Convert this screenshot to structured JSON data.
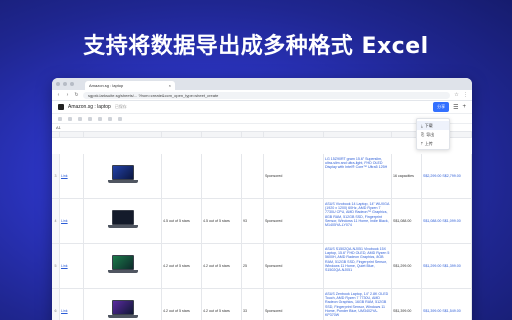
{
  "hero": {
    "title": "支持将数据导出成多种格式 Excel"
  },
  "browser": {
    "tab_title": "Amazon.sg : laptop",
    "url": "sgpxk.larksuite.sg/sheets/... ?from=create&ccm_open_type=sheet_create"
  },
  "app": {
    "doc_title": "Amazon.sg : laptop",
    "badge": "已保存",
    "share_label": "分享"
  },
  "dropdown": {
    "items": [
      {
        "label": "下载",
        "icon": "download-icon"
      },
      {
        "label": "导出",
        "icon": "export-icon"
      },
      {
        "label": "上传",
        "icon": "upload-icon"
      }
    ]
  },
  "formula": {
    "cell_ref": "A1"
  },
  "rows": [
    {
      "num": "3",
      "link": "Link",
      "rating": "",
      "rating2": "",
      "count": "",
      "sponsored": "Sponsored",
      "title": "LG 15Z90RT gram 15.6\" Superslim, ultra-slim and ultra-light, FHD OLED Display with Intel® Core™ Ultra5 125H",
      "price": "16 capacities",
      "prices": "S$2,299.00 S$2,799.00",
      "screen": "blue"
    },
    {
      "num": "4",
      "link": "Link",
      "rating": "4.5 out of 5 stars",
      "rating2": "4.5 out of 5 stars",
      "count": "93",
      "sponsored": "Sponsored",
      "title": "ASUS Vivobook 14 Laptop, 14\" WUXGA (1920 x 1200) 60Hz, AMD Ryzen 7 7730U CPU, AMD Radeon™ Graphics, 8GB RAM, 512GB SSD, Fingerprint Sensor, Windows 11 Home, Indie Black, M1405YA-LY074",
      "price": "S$1,088.00",
      "prices": "S$1,088.00 S$1,099.00",
      "screen": "dark"
    },
    {
      "num": "5",
      "link": "Link",
      "rating": "4.2 out of 5 stars",
      "rating2": "4.2 out of 5 stars",
      "count": "25",
      "sponsored": "Sponsored",
      "title": "ASUS S1502QA-NJ051 Vivobook 15X Laptop, 15.6\" FHD OLED, AMD Ryzen 5 5600H, AMD Radeon Graphics, 8GB RAM, 512GB SSD, Fingerprint Sensor, Windows 11 Home, Quiet Blue, S1502QA-NJ051",
      "price": "S$1,299.00",
      "prices": "S$1,299.00 S$1,399.00",
      "screen": "green"
    },
    {
      "num": "6",
      "link": "Link",
      "rating": "4.2 out of 5 stars",
      "rating2": "4.2 out of 5 stars",
      "count": "33",
      "sponsored": "Sponsored",
      "title": "ASUS Zenbook Laptop, 14\" 2.8K OLED Touch, AMD Ryzen 7 7730U, AMD Radeon Graphics, 16GB RAM, 512GB SSD, Fingerprint Sensor, Windows 11 Home, Ponder Blue, UM3402YA-KP370W",
      "price": "S$1,399.00",
      "prices": "S$1,399.00 S$1,549.00",
      "screen": "purple"
    }
  ]
}
